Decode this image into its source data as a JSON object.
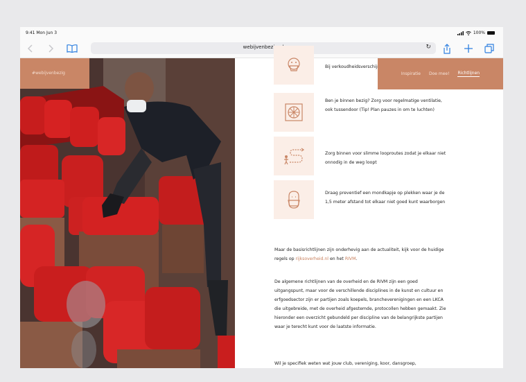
{
  "status": {
    "time": "9:41  Mon Jun 3",
    "battery": "100%"
  },
  "browser": {
    "url": "webijvenbezig.nl"
  },
  "brand": {
    "tag": "#webijvenbezig"
  },
  "nav": {
    "items": [
      "Inspiratie",
      "Doe mee!",
      "Richtlijnen"
    ],
    "active_index": 2
  },
  "tips": [
    {
      "icon": "face-mask-icon",
      "text": "Bij verkoudheidsverschijnselen"
    },
    {
      "icon": "ventilation-icon",
      "text": "Ben je binnen bezig? Zorg voor regelmatige ventilatie, ook tussendoor (Tip! Plan pauzes in om te luchten)"
    },
    {
      "icon": "walking-route-icon",
      "text": "Zorg binnen voor slimme looproutes zodat je elkaar niet onnodig in de weg loopt"
    },
    {
      "icon": "mouth-mask-icon",
      "text": "Draag preventief een mondkapje op plekken waar je de 1,5 meter afstand tot elkaar niet goed kunt waarborgen"
    }
  ],
  "body": {
    "p1_before": "Maar de basisrichtlijnen zijn onderhevig aan de actualiteit, kijk voor de huidige regels op ",
    "p1_link1": "rijksoverheid.nl",
    "p1_mid": " en het ",
    "p1_link2": "RIVM",
    "p1_after": ".",
    "p2": "De algemene richtlijnen van de overheid en de RIVM zijn een goed uitgangspunt, maar voor de verschillende disciplines in de kunst en cultuur en erfgoedsector zijn er partijen zoals koepels, brancheverenigingen en een LKCA die uitgebreide, met de overheid afgestemde, protocollen hebben gemaakt. Zie hieronder een overzicht gebundeld per discipline van de belangrijkste partijen waar je terecht kunt voor de laatste informatie.",
    "p3": "Wil je specifiek weten wat jouw club, vereniging, koor, dansgroep,"
  },
  "colors": {
    "accent": "#c98666",
    "link": "#c77e5b",
    "tip_bg": "#fbeee7",
    "ios_blue": "#2d7fe0",
    "seat_red": "#c21818"
  }
}
